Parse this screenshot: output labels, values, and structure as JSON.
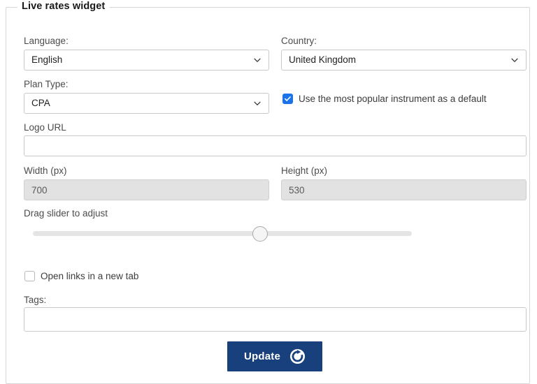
{
  "widget": {
    "legend": "Live rates widget",
    "fields": {
      "language": {
        "label": "Language:",
        "value": "English",
        "icon": "chevron-down-icon"
      },
      "country": {
        "label": "Country:",
        "value": "United Kingdom",
        "icon": "chevron-down-icon"
      },
      "plan_type": {
        "label": "Plan Type:",
        "value": "CPA",
        "icon": "chevron-down-icon"
      },
      "popular_instrument": {
        "label": "Use the most popular instrument as a default",
        "checked": "true",
        "icon": "checkmark-icon"
      },
      "logo_url": {
        "label": "Logo URL",
        "value": "",
        "placeholder": ""
      },
      "width": {
        "label": "Width (px)",
        "value": "700",
        "disabled": "true"
      },
      "height": {
        "label": "Height (px)",
        "value": "530",
        "disabled": "true"
      },
      "slider": {
        "label": "Drag slider to adjust",
        "value": 60,
        "min": 0,
        "max": 100
      },
      "new_tab": {
        "label": "Open links in a new tab",
        "checked": "false"
      },
      "tags": {
        "label": "Tags:",
        "value": "",
        "placeholder": ""
      }
    },
    "submit": {
      "label": "Update",
      "icon": "refresh-icon"
    }
  },
  "colors": {
    "accent_blue": "#1a73e8",
    "button_navy": "#18407c",
    "border_gray": "#c9c9c9",
    "disabled_bg": "#e2e2e2",
    "label_gray": "#4c4c4c"
  }
}
